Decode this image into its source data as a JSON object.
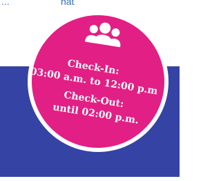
{
  "top_snippet": {
    "left": "...",
    "right": "nat"
  },
  "badge": {
    "icon": "users-group-icon",
    "checkin_label": "Check-In:",
    "checkin_hours": "03:00 a.m. to 12:00 p.m",
    "checkout_label": "Check-Out:",
    "checkout_hours": "until 02:00 p.m."
  },
  "colors": {
    "badge": "#e21f84",
    "panel": "#3543a5",
    "snippet": "#2d6fb6",
    "text": "#ffffff"
  }
}
